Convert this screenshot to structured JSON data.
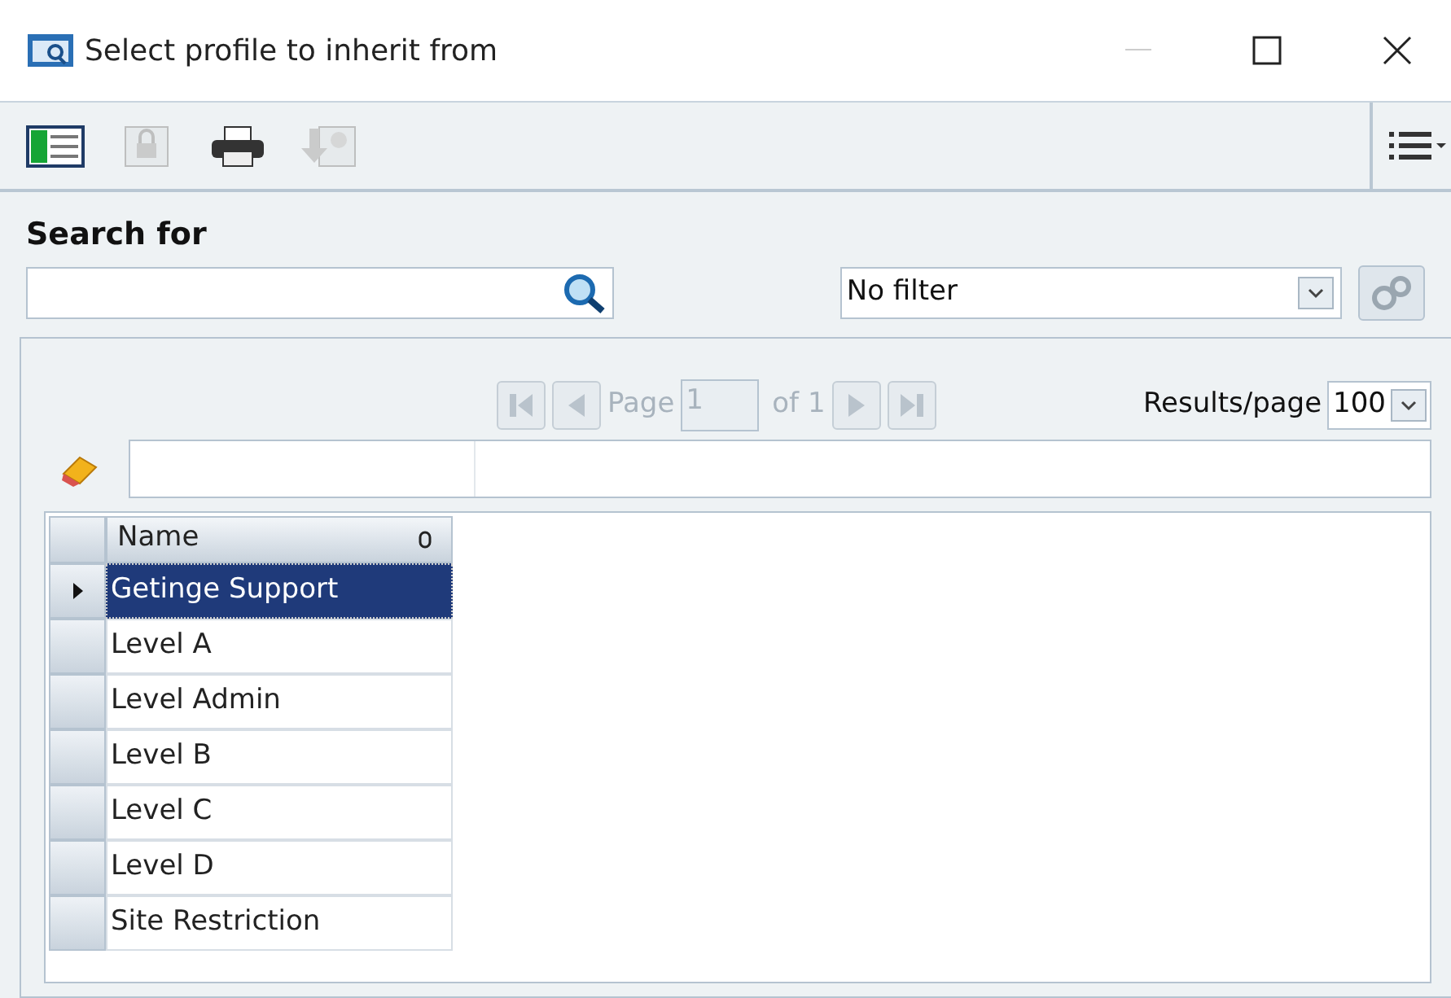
{
  "window": {
    "title": "Select profile to inherit from"
  },
  "toolbar": [
    {
      "kind": "grid",
      "disabled": false
    },
    {
      "kind": "lock",
      "disabled": true
    },
    {
      "kind": "print",
      "disabled": false
    },
    {
      "kind": "import",
      "disabled": true
    }
  ],
  "search": {
    "label": "Search for",
    "filter": "No filter"
  },
  "pager": {
    "page_label": "Page",
    "page": "1",
    "of": "of 1",
    "disabled": true,
    "results_label": "Results/page",
    "results": "100"
  },
  "grid": {
    "column": "Name",
    "rows": [
      {
        "name": "Getinge Support",
        "selected": true
      },
      {
        "name": "Level A",
        "selected": false
      },
      {
        "name": "Level Admin",
        "selected": false
      },
      {
        "name": "Level B",
        "selected": false
      },
      {
        "name": "Level C",
        "selected": false
      },
      {
        "name": "Level D",
        "selected": false
      },
      {
        "name": "Site Restriction",
        "selected": false
      }
    ]
  }
}
